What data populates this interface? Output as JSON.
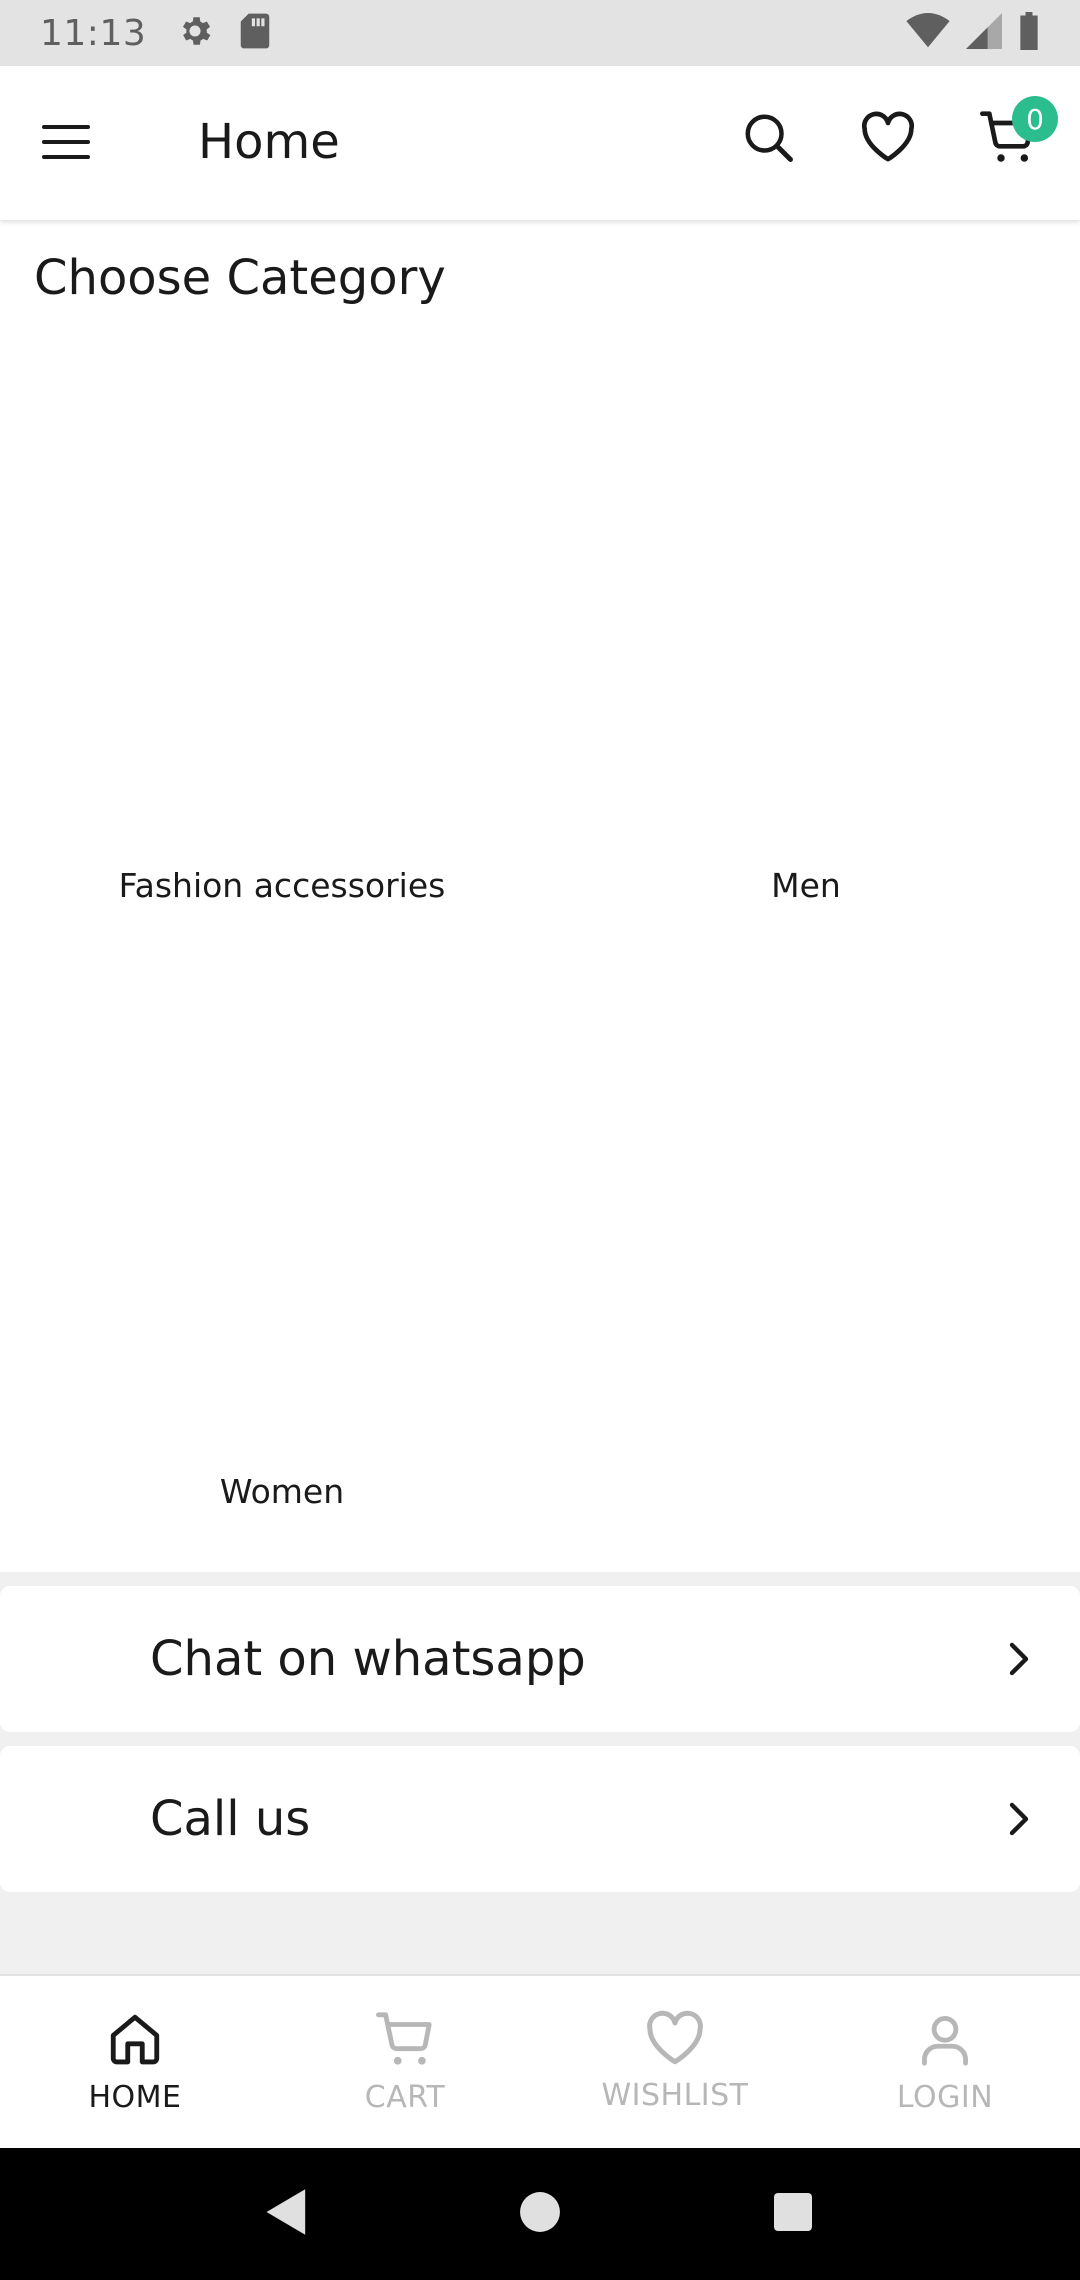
{
  "status_bar": {
    "time": "11:13",
    "icons": [
      "settings-icon",
      "sd-card-icon",
      "wifi-icon",
      "signal-icon",
      "battery-icon"
    ]
  },
  "app_bar": {
    "title": "Home",
    "cart_count": "0",
    "icons": [
      "menu-icon",
      "search-icon",
      "heart-icon",
      "cart-icon"
    ],
    "accent_color": "#2bbd8e"
  },
  "categories": {
    "heading": "Choose Category",
    "items": [
      {
        "label": "Fashion accessories"
      },
      {
        "label": "Men"
      },
      {
        "label": "Women"
      }
    ]
  },
  "actions": [
    {
      "label": "Chat on whatsapp"
    },
    {
      "label": "Call us"
    }
  ],
  "bottom_nav": {
    "items": [
      {
        "label": "HOME",
        "icon": "home-icon",
        "active": true
      },
      {
        "label": "CART",
        "icon": "cart-icon",
        "active": false
      },
      {
        "label": "WISHLIST",
        "icon": "heart-icon",
        "active": false
      },
      {
        "label": "LOGIN",
        "icon": "user-icon",
        "active": false
      }
    ]
  },
  "system_nav": {
    "icons": [
      "back-icon",
      "home-circle-icon",
      "recents-icon"
    ]
  }
}
